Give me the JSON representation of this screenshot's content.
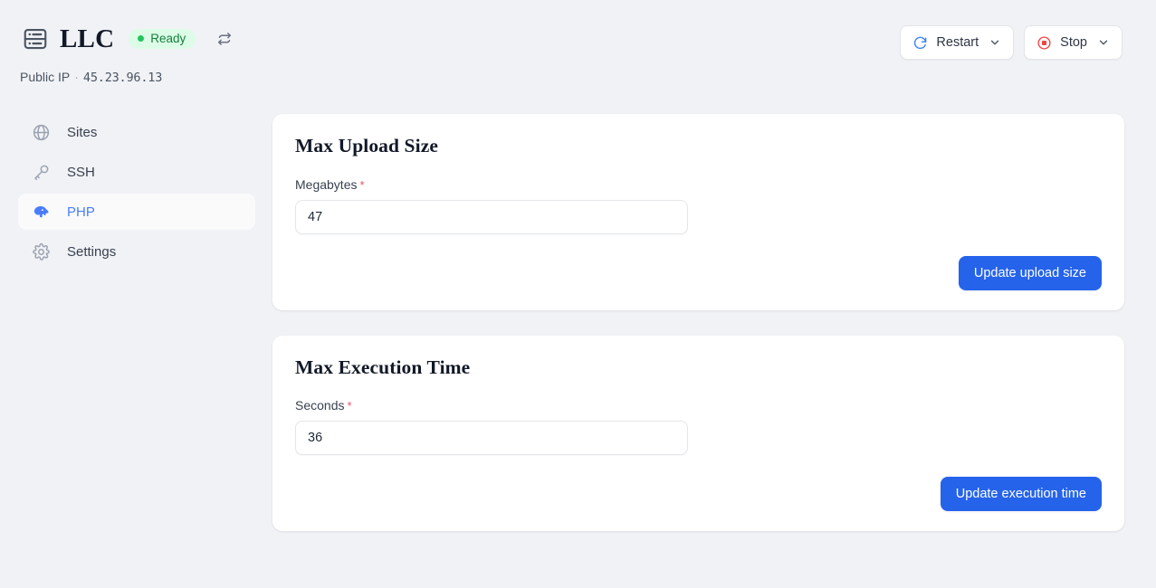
{
  "header": {
    "logo_icon": "server-rack-icon",
    "title": "LLC",
    "status": {
      "label": "Ready",
      "dot_color": "#22c55e",
      "bg_color": "#dcfce7",
      "text_color": "#15803d"
    },
    "refresh_icon": "refresh-sync-icon",
    "public_ip_label": "Public IP",
    "public_ip_separator": "·",
    "public_ip_value": "45.23.96.13",
    "actions": [
      {
        "label": "Restart",
        "icon": "restart-circle-arrow-icon",
        "icon_color": "#3b82f6",
        "caret": "chevron-down-icon"
      },
      {
        "label": "Stop",
        "icon": "stop-square-circle-icon",
        "icon_color": "#ef4444",
        "caret": "chevron-down-icon"
      }
    ]
  },
  "sidebar": {
    "items": [
      {
        "label": "Sites",
        "icon": "globe-icon",
        "active": false
      },
      {
        "label": "SSH",
        "icon": "key-icon",
        "active": false
      },
      {
        "label": "PHP",
        "icon": "php-elephant-icon",
        "active": true
      },
      {
        "label": "Settings",
        "icon": "gear-icon",
        "active": false
      }
    ]
  },
  "main": {
    "cards": [
      {
        "title": "Max Upload Size",
        "field_label": "Megabytes",
        "required_mark": "*",
        "value": "47",
        "placeholder": "",
        "button_label": "Update upload size"
      },
      {
        "title": "Max Execution Time",
        "field_label": "Seconds",
        "required_mark": "*",
        "value": "36",
        "placeholder": "",
        "button_label": "Update execution time"
      }
    ]
  },
  "theme": {
    "page_bg": "#f1f2f5",
    "card_bg": "#ffffff",
    "primary": "#2563eb",
    "accent_link": "#4a7dfc"
  }
}
